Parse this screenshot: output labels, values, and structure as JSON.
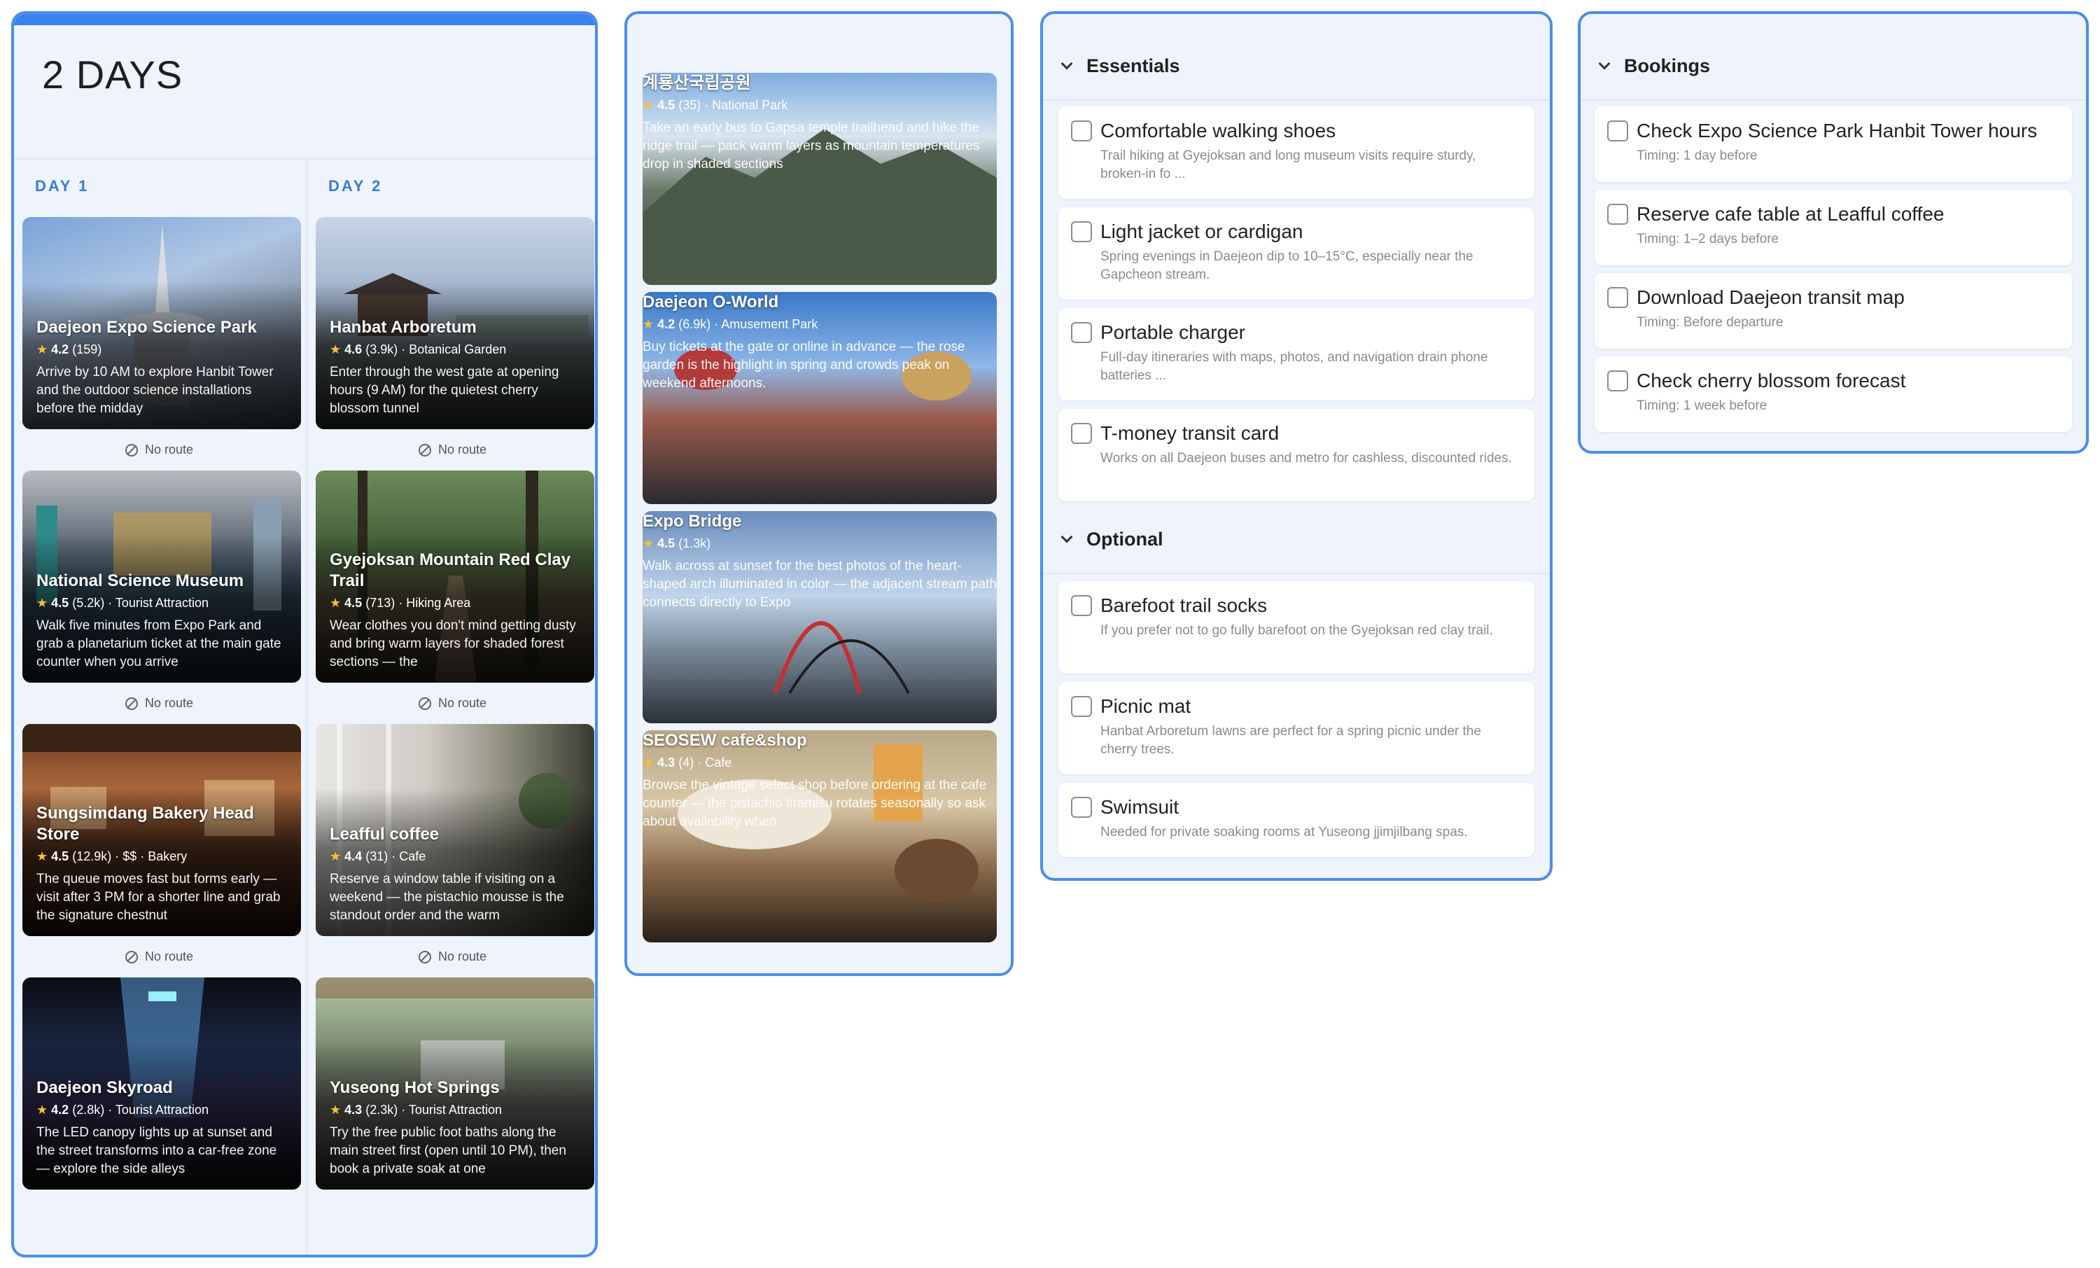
{
  "itinerary": {
    "title": "2 DAYS",
    "no_route_label": "No route",
    "days": [
      {
        "label": "DAY 1",
        "places": [
          {
            "name": "Daejeon Expo Science Park",
            "rating": "4.2",
            "reviews": "(159)",
            "category": "",
            "desc": "Arrive by 10 AM to explore Hanbit Tower and the outdoor science installations before the midday"
          },
          {
            "name": "National Science Museum",
            "rating": "4.5",
            "reviews": "(5.2k)",
            "category": "· Tourist Attraction",
            "desc": "Walk five minutes from Expo Park and grab a planetarium ticket at the main gate counter when you arrive"
          },
          {
            "name": "Sungsimdang Bakery Head Store",
            "rating": "4.5",
            "reviews": "(12.9k)",
            "category": "· $$ · Bakery",
            "desc": "The queue moves fast but forms early — visit after 3 PM for a shorter line and grab the signature chestnut"
          },
          {
            "name": "Daejeon Skyroad",
            "rating": "4.2",
            "reviews": "(2.8k)",
            "category": "· Tourist Attraction",
            "desc": "The LED canopy lights up at sunset and the street transforms into a car-free zone — explore the side alleys"
          }
        ]
      },
      {
        "label": "DAY 2",
        "places": [
          {
            "name": "Hanbat Arboretum",
            "rating": "4.6",
            "reviews": "(3.9k)",
            "category": "· Botanical Garden",
            "desc": "Enter through the west gate at opening hours (9 AM) for the quietest cherry blossom tunnel"
          },
          {
            "name": "Gyejoksan Mountain Red Clay Trail",
            "rating": "4.5",
            "reviews": "(713)",
            "category": "· Hiking Area",
            "desc": "Wear clothes you don't mind getting dusty and bring warm layers for shaded forest sections — the"
          },
          {
            "name": "Leafful coffee",
            "rating": "4.4",
            "reviews": "(31)",
            "category": "· Cafe",
            "desc": "Reserve a window table if visiting on a weekend — the pistachio mousse is the standout order and the warm"
          },
          {
            "name": "Yuseong Hot Springs",
            "rating": "4.3",
            "reviews": "(2.3k)",
            "category": "· Tourist Attraction",
            "desc": "Try the free public foot baths along the main street first (open until 10 PM), then book a private soak at one"
          }
        ]
      }
    ]
  },
  "ideas": [
    {
      "name": "계룡산국립공원",
      "rating": "4.5",
      "reviews": "(35)",
      "category": "· National Park",
      "desc": "Take an early bus to Gapsa temple trailhead and hike the ridge trail — pack warm layers as mountain temperatures drop in shaded sections"
    },
    {
      "name": "Daejeon O-World",
      "rating": "4.2",
      "reviews": "(6.9k)",
      "category": "· Amusement Park",
      "desc": "Buy tickets at the gate or online in advance — the rose garden is the highlight in spring and crowds peak on weekend afternoons."
    },
    {
      "name": "Expo Bridge",
      "rating": "4.5",
      "reviews": "(1.3k)",
      "category": "",
      "desc": "Walk across at sunset for the best photos of the heart-shaped arch illuminated in color — the adjacent stream path connects directly to Expo"
    },
    {
      "name": "SEOSEW cafe&shop",
      "rating": "4.3",
      "reviews": "(4)",
      "category": "· Cafe",
      "desc": "Browse the vintage select shop before ordering at the cafe counter — the pistachio tiramisu rotates seasonally so ask about availability when"
    }
  ],
  "checklists": {
    "essentials": {
      "title": "Essentials",
      "items": [
        {
          "title": "Comfortable walking shoes",
          "note": "Trail hiking at Gyejoksan and long museum visits require sturdy, broken-in fo ..."
        },
        {
          "title": "Light jacket or cardigan",
          "note": "Spring evenings in Daejeon dip to 10–15°C, especially near the Gapcheon stream."
        },
        {
          "title": "Portable charger",
          "note": "Full-day itineraries with maps, photos, and navigation drain phone batteries  ..."
        },
        {
          "title": "T-money transit card",
          "note": "Works on all Daejeon buses and metro for cashless, discounted rides."
        }
      ]
    },
    "optional": {
      "title": "Optional",
      "items": [
        {
          "title": "Barefoot trail socks",
          "note": "If you prefer not to go fully barefoot on the Gyejoksan red clay trail."
        },
        {
          "title": "Picnic mat",
          "note": "Hanbat Arboretum lawns are perfect for a spring picnic under the cherry trees."
        },
        {
          "title": "Swimsuit",
          "note": "Needed for private soaking rooms at Yuseong jjimjilbang spas."
        }
      ]
    },
    "bookings": {
      "title": "Bookings",
      "items": [
        {
          "title": "Check Expo Science Park Hanbit Tower hours",
          "note": "Timing: 1 day before"
        },
        {
          "title": "Reserve cafe table at Leafful coffee",
          "note": "Timing: 1–2 days before"
        },
        {
          "title": "Download Daejeon transit map",
          "note": "Timing: Before departure"
        },
        {
          "title": "Check cherry blossom forecast",
          "note": "Timing: 1 week before"
        }
      ]
    }
  },
  "colors": {
    "accent": "#3b82ee",
    "panel_bg": "#eef3fc",
    "star": "#f6c136",
    "day_label": "#3a7bd5"
  }
}
